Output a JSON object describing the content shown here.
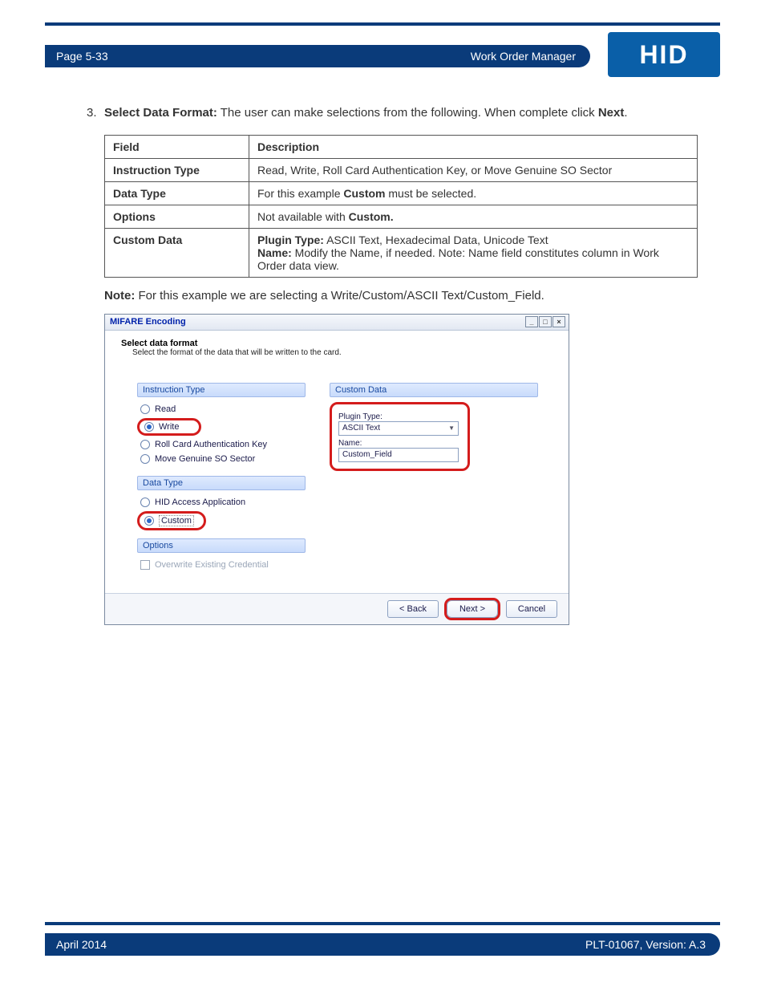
{
  "header": {
    "page_label": "Page 5-33",
    "title": "Work Order Manager",
    "logo_text": "HID"
  },
  "step": {
    "number": "3.",
    "lead_bold": "Select Data Format:",
    "lead_rest": " The user can make selections from the following. When complete click ",
    "next_bold": "Next",
    "period": "."
  },
  "table": {
    "head_field": "Field",
    "head_desc": "Description",
    "rows": {
      "r1_field": "Instruction Type",
      "r1_desc": "Read, Write, Roll Card Authentication Key, or Move Genuine SO Sector",
      "r2_field": "Data Type",
      "r2_desc_a": "For this example ",
      "r2_desc_b": "Custom",
      "r2_desc_c": " must be selected.",
      "r3_field": "Options",
      "r3_desc_a": "Not available with ",
      "r3_desc_b": "Custom.",
      "r4_field": "Custom Data",
      "r4_l1_a": "Plugin Type:",
      "r4_l1_b": " ASCII Text, Hexadecimal Data, Unicode Text",
      "r4_l2_a": "Name:",
      "r4_l2_b": " Modify the Name, if needed. Note: Name field constitutes column in Work Order data view."
    }
  },
  "note": {
    "bold": "Note:",
    "text": " For this example we are selecting a Write/Custom/ASCII Text/Custom_Field."
  },
  "dialog": {
    "title": "MIFARE Encoding",
    "head1": "Select data format",
    "head2": "Select the format of the data that will be written to the card.",
    "grp_instruction": "Instruction Type",
    "opt_read": "Read",
    "opt_write": "Write",
    "opt_roll": "Roll Card Authentication Key",
    "opt_move": "Move Genuine SO Sector",
    "grp_datatype": "Data Type",
    "opt_hid": "HID Access Application",
    "opt_custom": "Custom",
    "grp_options": "Options",
    "opt_overwrite": "Overwrite Existing Credential",
    "grp_customdata": "Custom Data",
    "lbl_plugin": "Plugin Type:",
    "val_plugin": "ASCII Text",
    "lbl_name": "Name:",
    "val_name": "Custom_Field",
    "btn_back": "< Back",
    "btn_next": "Next >",
    "btn_cancel": "Cancel"
  },
  "footer": {
    "date": "April 2014",
    "doc": "PLT-01067, Version: A.3"
  }
}
